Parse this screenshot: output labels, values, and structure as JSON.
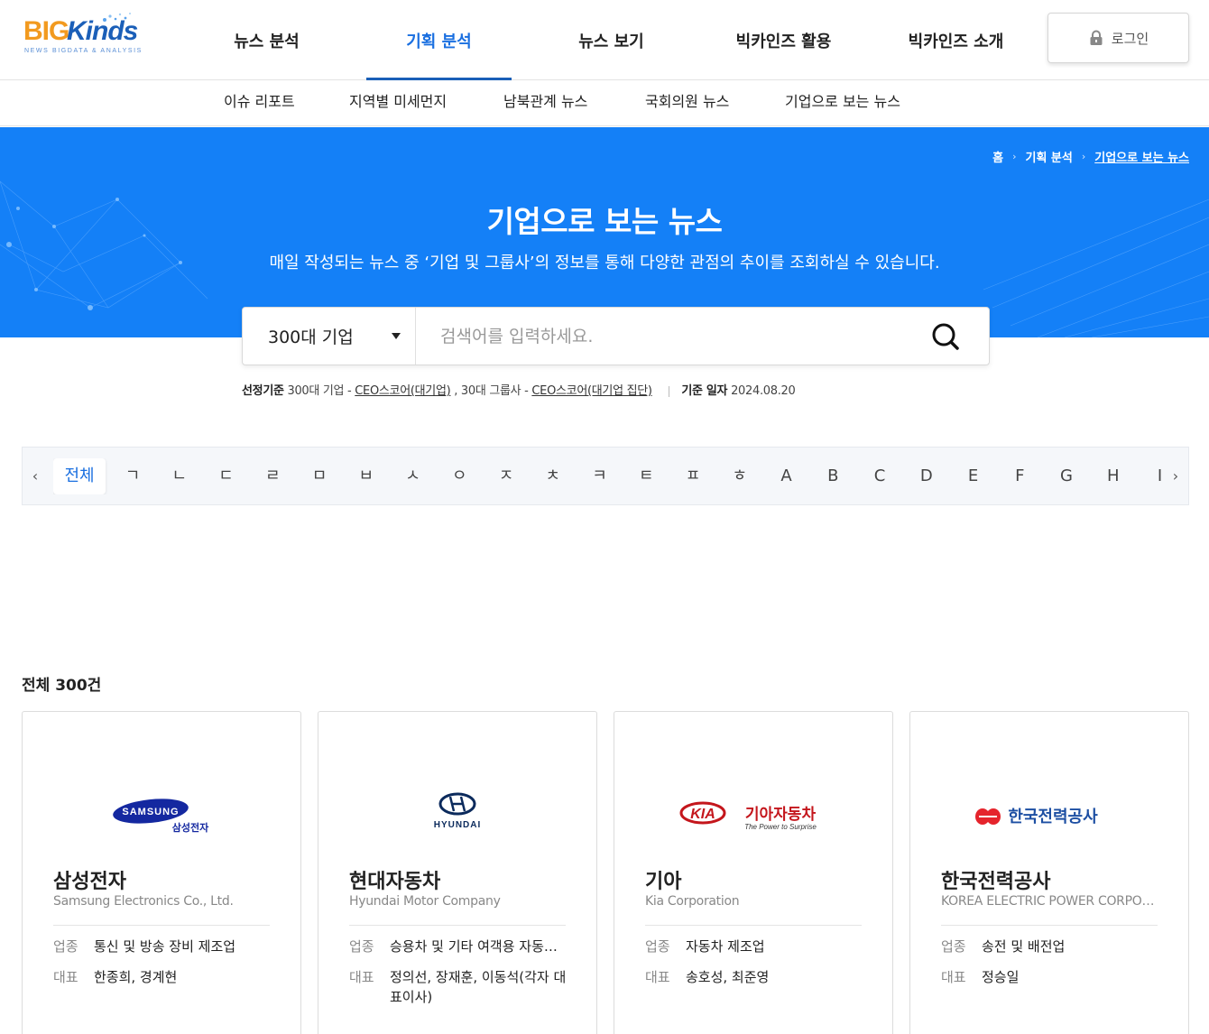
{
  "header": {
    "logo_main": "BIG",
    "logo_accent": "Kinds",
    "logo_sub": "NEWS BIGDATA & ANALYSIS",
    "nav": [
      {
        "label": "뉴스 분석"
      },
      {
        "label": "기획 분석"
      },
      {
        "label": "뉴스 보기"
      },
      {
        "label": "빅카인즈 활용"
      },
      {
        "label": "빅카인즈 소개"
      }
    ],
    "active_nav": 1,
    "login_label": "로그인"
  },
  "subnav": [
    "이슈 리포트",
    "지역별 미세먼지",
    "남북관계 뉴스",
    "국회의원 뉴스",
    "기업으로 보는 뉴스"
  ],
  "breadcrumb": [
    "홈",
    "기획 분석",
    "기업으로 보는 뉴스"
  ],
  "hero": {
    "title": "기업으로 보는 뉴스",
    "description": "매일 작성되는 뉴스 중 ‘기업 및 그룹사’의 정보를 통해 다양한 관점의 추이를 조회하실 수 있습니다."
  },
  "search": {
    "selected": "300대 기업",
    "placeholder": "검색어를 입력하세요."
  },
  "criteria": {
    "label": "선정기준",
    "part1": "300대 기업 - ",
    "link1": "CEO스코어(대기업)",
    "part2": " , 30대 그룹사 - ",
    "link2": "CEO스코어(대기업 집단)",
    "date_label": "기준 일자",
    "date_value": "2024.08.20"
  },
  "alphabet": {
    "items": [
      "전체",
      "ㄱ",
      "ㄴ",
      "ㄷ",
      "ㄹ",
      "ㅁ",
      "ㅂ",
      "ㅅ",
      "ㅇ",
      "ㅈ",
      "ㅊ",
      "ㅋ",
      "ㅌ",
      "ㅍ",
      "ㅎ",
      "A",
      "B",
      "C",
      "D",
      "E",
      "F",
      "G",
      "H",
      "I"
    ],
    "active": 0,
    "prev": "‹",
    "next": "›"
  },
  "total_label": "전체 300건",
  "row_labels": {
    "industry": "업종",
    "ceo": "대표"
  },
  "companies": [
    {
      "name": "삼성전자",
      "english": "Samsung Electronics Co., Ltd.",
      "industry": "통신 및 방송 장비 제조업",
      "ceo": "한종희, 경계현",
      "logo_text": "SAMSUNG",
      "logo_sub": "삼성전자"
    },
    {
      "name": "현대자동차",
      "english": "Hyundai Motor Company",
      "industry": "승용차 및 기타 여객용 자동차 제조업",
      "ceo": "정의선, 장재훈, 이동석(각자 대표이사)",
      "logo_text": "HYUNDAI"
    },
    {
      "name": "기아",
      "english": "Kia Corporation",
      "industry": "자동차 제조업",
      "ceo": "송호성, 최준영",
      "logo_text": "KIA",
      "logo_sub": "기아자동차",
      "logo_tagline": "The Power to Surprise"
    },
    {
      "name": "한국전력공사",
      "english": "KOREA ELECTRIC POWER CORPORATION",
      "industry": "송전 및 배전업",
      "ceo": "정승일",
      "logo_text": "한국전력공사"
    }
  ],
  "colors": {
    "brand_blue": "#1480f7",
    "accent": "#1a6fe0",
    "samsung": "#1428a0",
    "kia": "#c4161c",
    "kepco": "#e5242c"
  }
}
